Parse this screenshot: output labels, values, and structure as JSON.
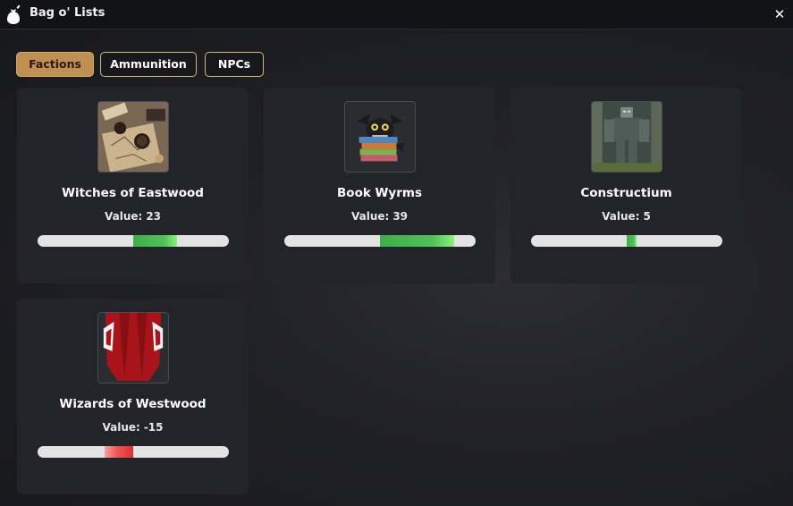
{
  "window": {
    "title": "Bag o' Lists",
    "close_label": "✕"
  },
  "tabs": [
    {
      "label": "Factions",
      "active": true
    },
    {
      "label": "Ammunition",
      "active": false
    },
    {
      "label": "NPCs",
      "active": false
    }
  ],
  "factions": [
    {
      "name": "Witches of Eastwood",
      "value_label": "Value:",
      "value": "23",
      "bar_value": 23,
      "image": "witches-map-image"
    },
    {
      "name": "Book Wyrms",
      "value_label": "Value:",
      "value": "39",
      "bar_value": 39,
      "image": "book-dragon-image"
    },
    {
      "name": "Constructium",
      "value_label": "Value:",
      "value": "5",
      "bar_value": 5,
      "image": "stone-golem-image"
    },
    {
      "name": "Wizards of Westwood",
      "value_label": "Value:",
      "value": "-15",
      "bar_value": -15,
      "image": "red-robe-image"
    }
  ],
  "bar_range": [
    -50,
    50
  ],
  "colors": {
    "accent": "#c08f52",
    "positive": "#4fc05a",
    "negative": "#e03a3a",
    "card_bg": "#23242a"
  }
}
